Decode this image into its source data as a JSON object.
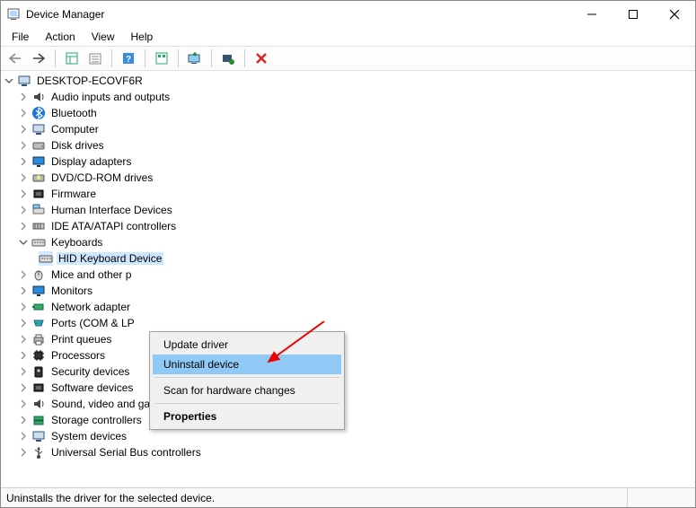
{
  "window": {
    "title": "Device Manager"
  },
  "menu": {
    "file": "File",
    "action": "Action",
    "view": "View",
    "help": "Help"
  },
  "tree": {
    "root": "DESKTOP-ECOVF6R",
    "audio": "Audio inputs and outputs",
    "bluetooth": "Bluetooth",
    "computer": "Computer",
    "disk": "Disk drives",
    "display": "Display adapters",
    "dvd": "DVD/CD-ROM drives",
    "firmware": "Firmware",
    "hid": "Human Interface Devices",
    "ide": "IDE ATA/ATAPI controllers",
    "keyboards": "Keyboards",
    "kbchild": "HID Keyboard Device",
    "mice": "Mice and other p",
    "monitors": "Monitors",
    "network": "Network adapter",
    "ports": "Ports (COM & LP",
    "print": "Print queues",
    "processors": "Processors",
    "security": "Security devices",
    "software": "Software devices",
    "sound": "Sound, video and game controllers",
    "storage": "Storage controllers",
    "system": "System devices",
    "usb": "Universal Serial Bus controllers"
  },
  "context": {
    "update": "Update driver",
    "uninstall": "Uninstall device",
    "scan": "Scan for hardware changes",
    "properties": "Properties"
  },
  "status": "Uninstalls the driver for the selected device."
}
